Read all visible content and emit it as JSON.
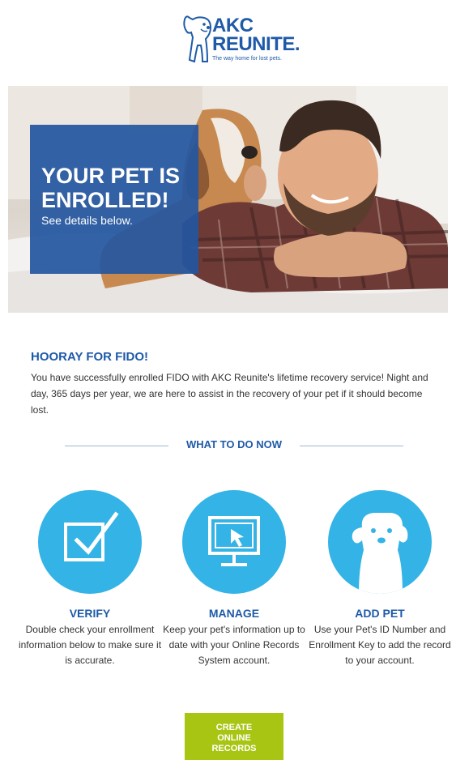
{
  "brand": {
    "logo_line1": "AKC",
    "logo_line2": "REUNITE.",
    "tagline": "The way home for lost pets.",
    "logo_icon": "dog-logo-icon",
    "color": "#1e5aa8"
  },
  "hero": {
    "headline": "YOUR PET IS ENROLLED!",
    "subtext": "See details below.",
    "overlay_color": "#2356a0"
  },
  "message": {
    "title": "HOORAY FOR FIDO!",
    "body": "You have successfully enrolled FIDO with AKC Reunite's lifetime recovery service! Night and day, 365 days per year, we are here to assist in the recovery of your pet if it should become lost."
  },
  "section": {
    "title": "WHAT TO DO NOW"
  },
  "steps": [
    {
      "icon": "checkbox-icon",
      "title": "VERIFY",
      "description": "Double check your enrollment information below to make sure it is accurate."
    },
    {
      "icon": "monitor-cursor-icon",
      "title": "MANAGE",
      "description": "Keep your pet's information up to date with your Online Records System account."
    },
    {
      "icon": "dog-silhouette-icon",
      "title": "ADD PET",
      "description": "Use your Pet's ID Number and Enrollment Key to add the record to your account."
    }
  ],
  "cta": {
    "label_line1": "CREATE",
    "label_line2": "ONLINE",
    "label_line3": "RECORDS",
    "color": "#a8c514"
  },
  "colors": {
    "circle": "#33b3e6",
    "accent_blue": "#1e5aa8"
  }
}
